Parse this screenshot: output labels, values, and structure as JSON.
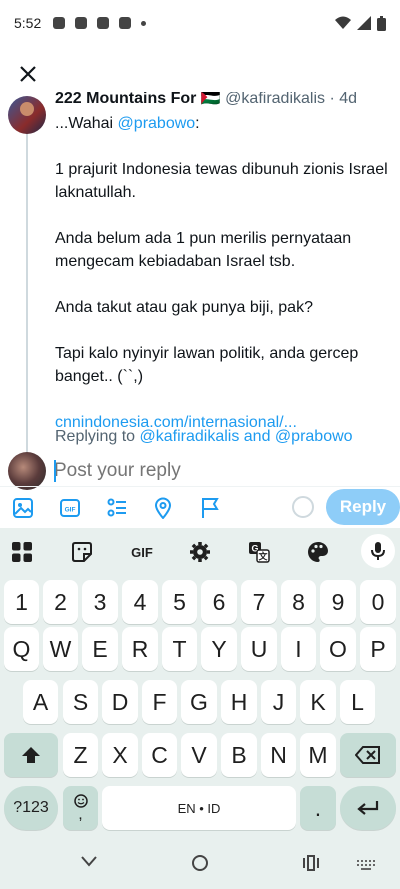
{
  "status_bar": {
    "time": "5:52"
  },
  "tweet": {
    "author_name": "222 Mountains For 🇵🇸",
    "author_meta": "@kafiradikalis · 4d",
    "greeting_prefix": "...Wahai ",
    "greeting_mention": "@prabowo",
    "greeting_suffix": ":",
    "para1": "1 prajurit Indonesia tewas dibunuh zionis Israel laknatullah.",
    "para2": "Anda belum ada 1 pun merilis pernyataan mengecam kebiadaban Israel tsb.",
    "para3": "Anda takut atau gak punya biji, pak?",
    "para4": "Tapi kalo nyinyir lawan politik, anda gercep banget.. (``,)",
    "link": "cnnindonesia.com/internasional/...",
    "replying_prefix": "Replying to ",
    "replying_user1": "@kafiradikalis",
    "replying_and": " and ",
    "replying_user2": "@prabowo"
  },
  "composer": {
    "placeholder": "Post your reply",
    "reply_label": "Reply"
  },
  "keyboard": {
    "gif_label": "GIF",
    "row_numbers": [
      "1",
      "2",
      "3",
      "4",
      "5",
      "6",
      "7",
      "8",
      "9",
      "0"
    ],
    "row_q": [
      "Q",
      "W",
      "E",
      "R",
      "T",
      "Y",
      "U",
      "I",
      "O",
      "P"
    ],
    "row_a": [
      "A",
      "S",
      "D",
      "F",
      "G",
      "H",
      "J",
      "K",
      "L"
    ],
    "row_z": [
      "Z",
      "X",
      "C",
      "V",
      "B",
      "N",
      "M"
    ],
    "symbols_label": "?123",
    "emoji_comma": ",",
    "space_label": "EN • ID",
    "period_label": "."
  },
  "colors": {
    "accent": "#1d9bf0",
    "reply_button": "#8ecdf8",
    "keyboard_bg": "#e8f0ee",
    "modifier_key": "#c6ddd6"
  },
  "icons": [
    "close-icon",
    "image-icon",
    "gif-icon",
    "poll-icon",
    "location-icon",
    "flag-icon",
    "apps-icon",
    "sticker-icon",
    "settings-icon",
    "translate-icon",
    "palette-icon",
    "mic-icon",
    "shift-icon",
    "backspace-icon",
    "enter-icon",
    "emoji-icon",
    "back-nav-icon",
    "home-nav-icon",
    "recents-nav-icon",
    "keyboard-switch-icon"
  ]
}
